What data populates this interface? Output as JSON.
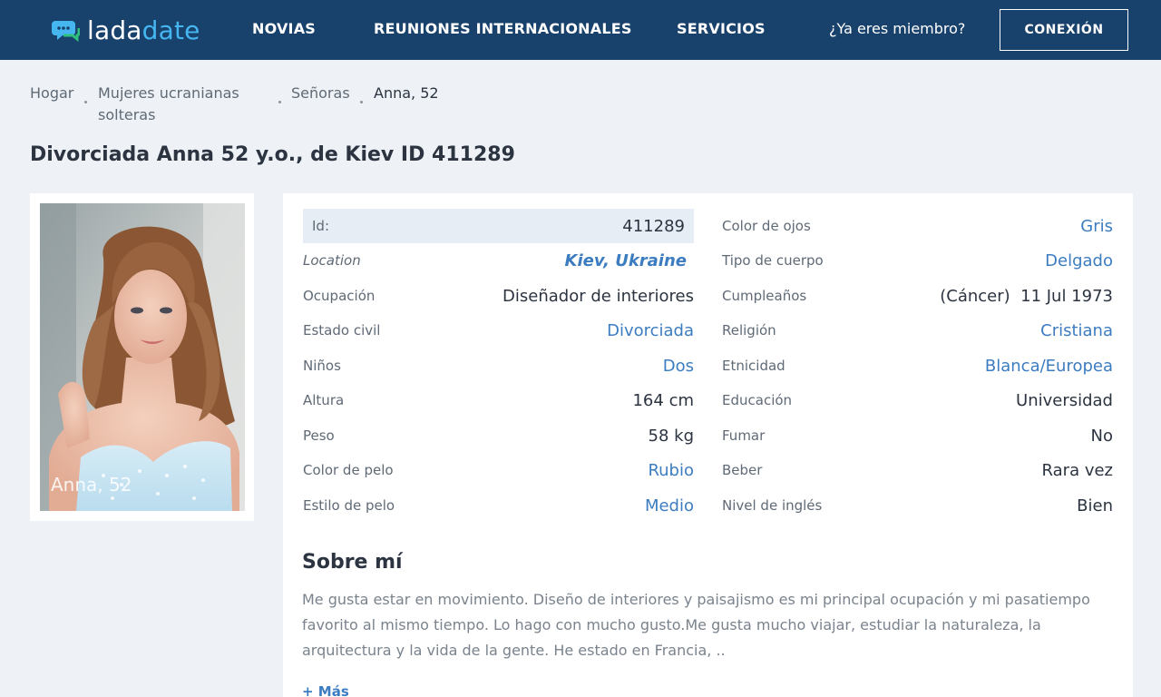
{
  "header": {
    "logo_part1": "lada",
    "logo_part2": "date",
    "nav": [
      "NOVIAS",
      "REUNIONES INTERNACIONALES",
      "SERVICIOS"
    ],
    "member_question": "¿Ya eres miembro?",
    "login_label": "CONEXIÓN"
  },
  "breadcrumb": {
    "home": "Hogar",
    "single_line1": "Mujeres ucranianas",
    "single_line2": "solteras",
    "ladies": "Señoras",
    "current": "Anna, 52"
  },
  "page_title": "Divorciada Anna 52 y.o., de Kiev ID 411289",
  "photo": {
    "caption": "Anna, 52"
  },
  "profile_left": [
    {
      "label": "Id:",
      "value": "411289"
    },
    {
      "label": "Location",
      "value": "Kiev, Ukraine"
    },
    {
      "label": "Ocupación",
      "value": "Diseñador de interiores"
    },
    {
      "label": "Estado civil",
      "value": "Divorciada"
    },
    {
      "label": "Niños",
      "value": "Dos"
    },
    {
      "label": "Altura",
      "value": "164 cm"
    },
    {
      "label": "Peso",
      "value": "58 kg"
    },
    {
      "label": "Color de pelo",
      "value": "Rubio"
    },
    {
      "label": "Estilo de pelo",
      "value": "Medio"
    }
  ],
  "profile_right": [
    {
      "label": "Color de ojos",
      "value": "Gris"
    },
    {
      "label": "Tipo de cuerpo",
      "value": "Delgado"
    },
    {
      "label": "Cumpleaños",
      "value": "(Cáncer)  11 Jul 1973"
    },
    {
      "label": "Religión",
      "value": "Cristiana"
    },
    {
      "label": "Etnicidad",
      "value": "Blanca/Europea"
    },
    {
      "label": "Educación",
      "value": "Universidad"
    },
    {
      "label": "Fumar",
      "value": "No"
    },
    {
      "label": "Beber",
      "value": "Rara vez"
    },
    {
      "label": "Nivel de inglés",
      "value": "Bien"
    }
  ],
  "about": {
    "title": "Sobre mí",
    "text": "Me gusta estar en movimiento. Diseño de interiores y paisajismo es mi principal ocupación y mi pasatiempo favorito al mismo tiempo. Lo hago con mucho gusto.Me gusta mucho viajar, estudiar la naturaleza, la arquitectura y la vida de la gente. He estado en Francia, ..",
    "more_label": "+ Más"
  },
  "colors": {
    "header_bg": "#18416c",
    "accent": "#45b6f0",
    "link": "#3c7cc0",
    "page_bg": "#eef2f6"
  }
}
